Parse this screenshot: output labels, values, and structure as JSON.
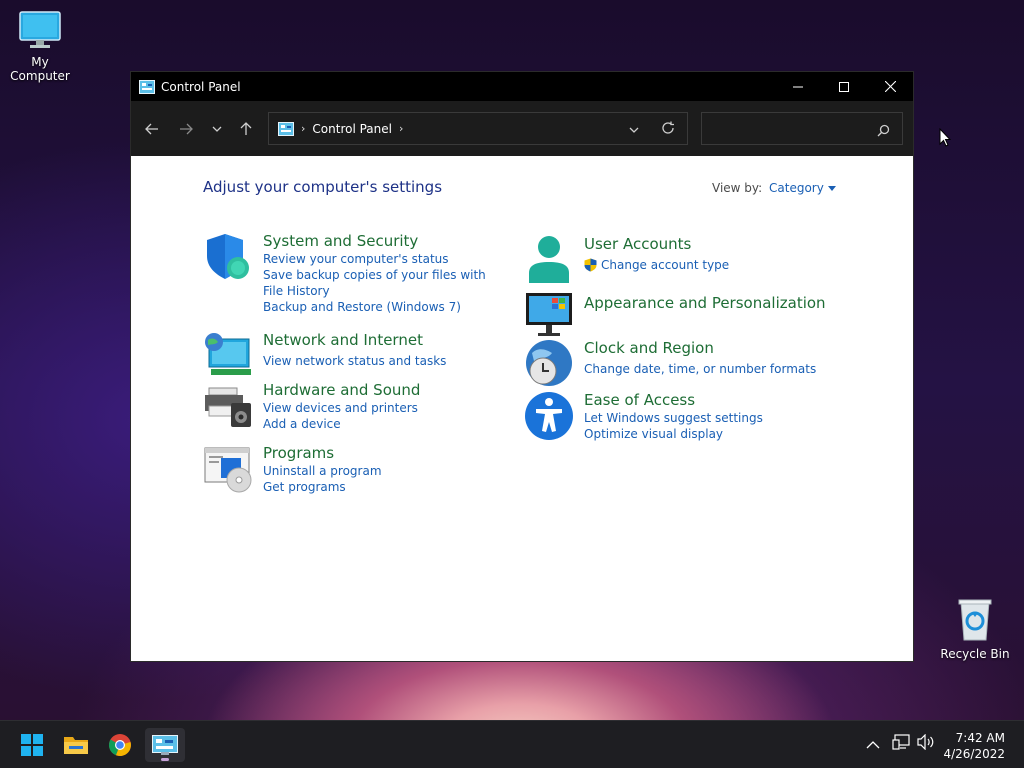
{
  "desktop": {
    "icons": [
      {
        "label": "My Computer"
      },
      {
        "label": "Recycle Bin"
      }
    ]
  },
  "window": {
    "title": "Control Panel",
    "address": {
      "crumb": "Control Panel"
    },
    "search": {
      "placeholder": ""
    }
  },
  "content": {
    "heading": "Adjust your computer's settings",
    "view_by_label": "View by:",
    "view_by_value": "Category",
    "categories_left": [
      {
        "title": "System and Security",
        "icon": "shield-icon",
        "links": [
          "Review your computer's status",
          "Save backup copies of your files with File History",
          "Backup and Restore (Windows 7)"
        ]
      },
      {
        "title": "Network and Internet",
        "icon": "network-globe-icon",
        "links": [
          "View network status and tasks"
        ]
      },
      {
        "title": "Hardware and Sound",
        "icon": "printer-speaker-icon",
        "links": [
          "View devices and printers",
          "Add a device"
        ]
      },
      {
        "title": "Programs",
        "icon": "programs-disc-icon",
        "links": [
          "Uninstall a program",
          "Get programs"
        ]
      }
    ],
    "categories_right": [
      {
        "title": "User Accounts",
        "icon": "user-icon",
        "links": [
          "Change account type"
        ]
      },
      {
        "title": "Appearance and Personalization",
        "icon": "monitor-icon",
        "links": []
      },
      {
        "title": "Clock and Region",
        "icon": "clock-globe-icon",
        "links": [
          "Change date, time, or number formats"
        ]
      },
      {
        "title": "Ease of Access",
        "icon": "accessibility-icon",
        "links": [
          "Let Windows suggest settings",
          "Optimize visual display"
        ]
      }
    ]
  },
  "taskbar": {
    "apps": [
      {
        "name": "start-icon"
      },
      {
        "name": "file-explorer-icon"
      },
      {
        "name": "chrome-icon"
      },
      {
        "name": "control-panel-icon"
      }
    ],
    "time": "7:42 AM",
    "date": "4/26/2022"
  },
  "colors": {
    "title_green": "#1e6d35",
    "link_blue": "#1a5fb4",
    "heading_blue": "#1e3287"
  }
}
